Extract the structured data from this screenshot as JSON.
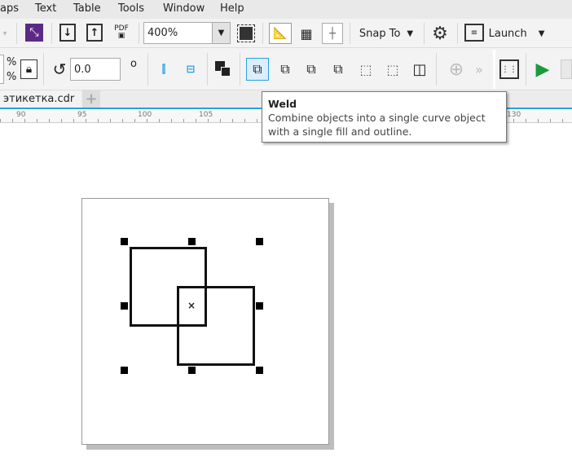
{
  "menu": [
    "aps",
    "Text",
    "Table",
    "Tools",
    "Window",
    "Help"
  ],
  "toolbar1": {
    "zoom_value": "400%",
    "pdf_label": "PDF",
    "snap_label": "Snap To",
    "launch_label": "Launch"
  },
  "toolbar2": {
    "percent1": "%",
    "percent2": "%",
    "rotation_value": "0.0",
    "degree_symbol": "o"
  },
  "tabs": [
    {
      "label": "этикетка.cdr",
      "active": true
    }
  ],
  "add_tab": "+",
  "ruler": [
    "90",
    "95",
    "100",
    "105",
    "130"
  ],
  "tooltip": {
    "title": "Weld",
    "description": "Combine objects into a single curve object with a single fill and outline."
  },
  "colors": {
    "accent": "#27a0e4",
    "import_export_icon": "#5b2a86",
    "play": "#1a9b3a"
  }
}
